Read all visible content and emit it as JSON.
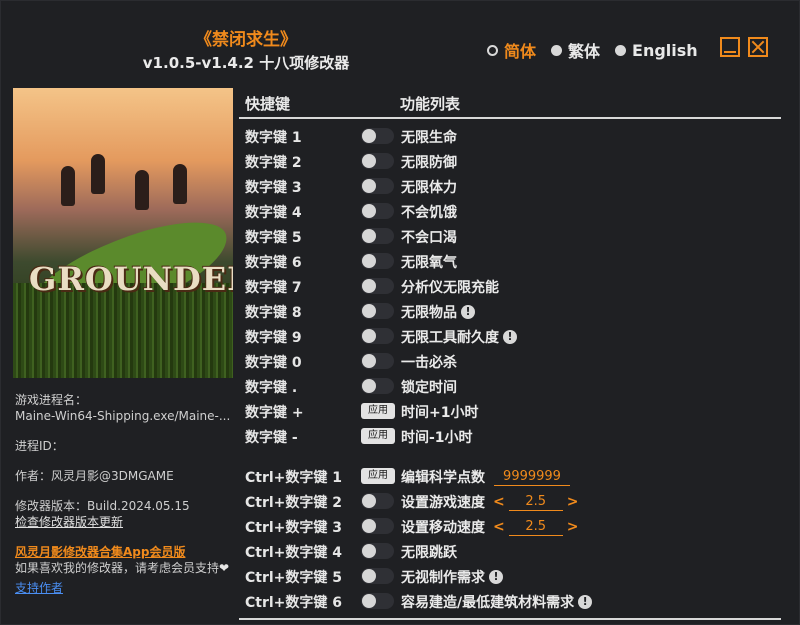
{
  "header": {
    "title": "《禁闭求生》",
    "subtitle": "v1.0.5-v1.4.2 十八项修改器"
  },
  "languages": [
    {
      "label": "简体",
      "selected": true
    },
    {
      "label": "繁体",
      "selected": false
    },
    {
      "label": "English",
      "selected": false
    }
  ],
  "colors": {
    "accent": "#f08a1c",
    "background": "#1f2023"
  },
  "cover": {
    "logo_text": "GROUNDED"
  },
  "info": {
    "process_label": "游戏进程名：",
    "process_value": "Maine-Win64-Shipping.exe/Maine-...",
    "pid_label": "进程ID：",
    "author": "作者：风灵月影@3DMGAME",
    "version": "修改器版本：Build.2024.05.15",
    "check_update": "检查修改器版本更新",
    "app_link": "风灵月影修改器合集App会员版",
    "support_text": "如果喜欢我的修改器，请考虑会员支持",
    "support_link": "支持作者"
  },
  "table": {
    "col_key": "快捷键",
    "col_fn": "功能列表",
    "apply_label": "应用",
    "rows_group1": [
      {
        "key": "数字键 1",
        "fn": "无限生命",
        "ctrl": "toggle",
        "info": false
      },
      {
        "key": "数字键 2",
        "fn": "无限防御",
        "ctrl": "toggle",
        "info": false
      },
      {
        "key": "数字键 3",
        "fn": "无限体力",
        "ctrl": "toggle",
        "info": false
      },
      {
        "key": "数字键 4",
        "fn": "不会饥饿",
        "ctrl": "toggle",
        "info": false
      },
      {
        "key": "数字键 5",
        "fn": "不会口渴",
        "ctrl": "toggle",
        "info": false
      },
      {
        "key": "数字键 6",
        "fn": "无限氧气",
        "ctrl": "toggle",
        "info": false
      },
      {
        "key": "数字键 7",
        "fn": "分析仪无限充能",
        "ctrl": "toggle",
        "info": false
      },
      {
        "key": "数字键 8",
        "fn": "无限物品",
        "ctrl": "toggle",
        "info": true
      },
      {
        "key": "数字键 9",
        "fn": "无限工具耐久度",
        "ctrl": "toggle",
        "info": true
      },
      {
        "key": "数字键 0",
        "fn": "一击必杀",
        "ctrl": "toggle",
        "info": false
      },
      {
        "key": "数字键 .",
        "fn": "锁定时间",
        "ctrl": "toggle",
        "info": false
      },
      {
        "key": "数字键 +",
        "fn": "时间+1小时",
        "ctrl": "apply",
        "info": false
      },
      {
        "key": "数字键 -",
        "fn": "时间-1小时",
        "ctrl": "apply",
        "info": false
      }
    ],
    "row_sci": {
      "key": "Ctrl+数字键 1",
      "fn": "编辑科学点数",
      "value": "9999999"
    },
    "row_game_speed": {
      "key": "Ctrl+数字键 2",
      "fn": "设置游戏速度",
      "value": "2.5",
      "left": "<",
      "right": ">"
    },
    "row_move_speed": {
      "key": "Ctrl+数字键 3",
      "fn": "设置移动速度",
      "value": "2.5",
      "left": "<",
      "right": ">"
    },
    "rows_group2": [
      {
        "key": "Ctrl+数字键 4",
        "fn": "无限跳跃",
        "info": false
      },
      {
        "key": "Ctrl+数字键 5",
        "fn": "无视制作需求",
        "info": true
      },
      {
        "key": "Ctrl+数字键 6",
        "fn": "容易建造/最低建筑材料需求",
        "info": true
      }
    ]
  }
}
